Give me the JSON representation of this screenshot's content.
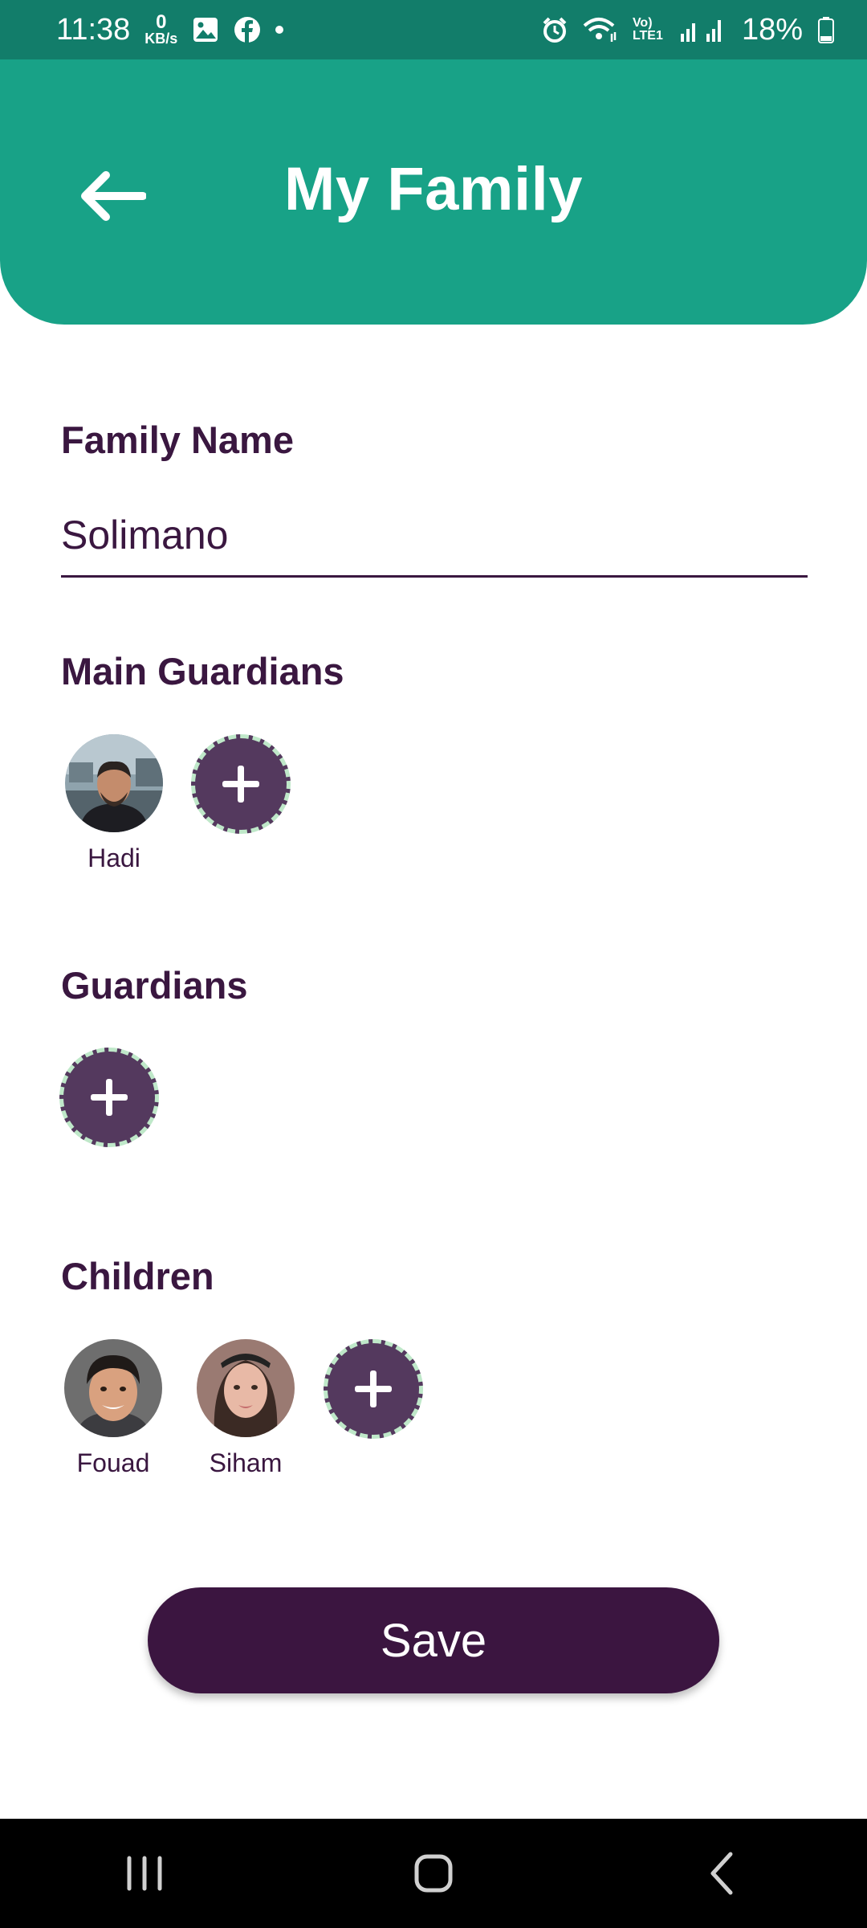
{
  "status_bar": {
    "time": "11:38",
    "net_speed_value": "0",
    "net_speed_unit": "KB/s",
    "network_label": "Vo) LTE1",
    "battery": "18%",
    "icons": [
      "gallery-icon",
      "facebook-icon",
      "alarm-icon",
      "wifi-icon",
      "signal-icon",
      "battery-icon"
    ]
  },
  "header": {
    "title": "My Family",
    "background_color": "#18a287"
  },
  "family_name": {
    "label": "Family Name",
    "value": "Solimano"
  },
  "main_guardians": {
    "label": "Main Guardians",
    "members": [
      {
        "name": "Hadi"
      }
    ],
    "add_icon": "plus-icon"
  },
  "guardians": {
    "label": "Guardians",
    "members": [],
    "add_icon": "plus-icon"
  },
  "children": {
    "label": "Children",
    "members": [
      {
        "name": "Fouad"
      },
      {
        "name": "Siham"
      }
    ],
    "add_icon": "plus-icon"
  },
  "actions": {
    "save_label": "Save",
    "save_color": "#3b1540"
  },
  "nav_bar": {
    "icons": [
      "recents-icon",
      "home-icon",
      "back-icon"
    ]
  }
}
